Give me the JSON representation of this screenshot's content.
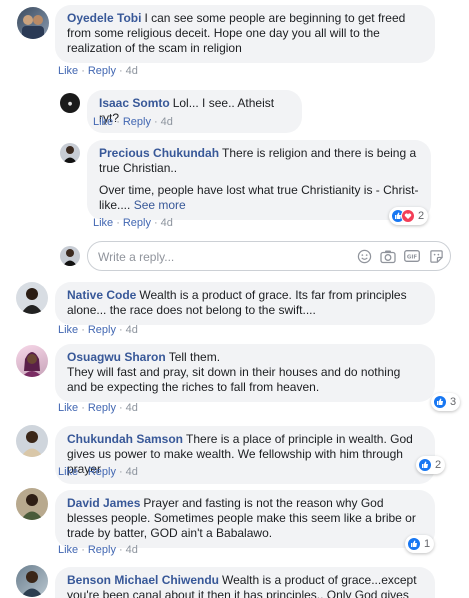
{
  "comments": [
    {
      "author": "Oyedele Tobi",
      "text": "I can see some people are beginning to get freed from some religious deceit. Hope one day you all will to the realization of the scam in religion",
      "like": "Like",
      "reply": "Reply",
      "time": "4d"
    },
    {
      "author": "Native Code",
      "text": "Wealth is a product of grace. Its far from principles alone... the race does not belong to the swift....",
      "like": "Like",
      "reply": "Reply",
      "time": "4d"
    },
    {
      "author": "Osuagwu Sharon",
      "text": "Tell them.",
      "text2": "They will fast and pray, sit down in their houses and do nothing and be expecting the riches to fall from heaven.",
      "like": "Like",
      "reply": "Reply",
      "time": "4d",
      "reactions": "3"
    },
    {
      "author": "Chukundah Samson",
      "text": "There is a place of principle in wealth. God gives us power to make wealth. We fellowship with him through prayer",
      "like": "Like",
      "reply": "Reply",
      "time": "4d",
      "reactions": "2"
    },
    {
      "author": "David James",
      "text": "Prayer and fasting is not the reason why God blesses people. Sometimes people make this seem like a bribe or trade by batter, GOD ain't a Babalawo.",
      "like": "Like",
      "reply": "Reply",
      "time": "4d",
      "reactions": "1"
    },
    {
      "author": "Benson Michael Chiwendu",
      "text": "Wealth is a product of grace...except you're been canal about it then it has principles.. Only God gives and"
    }
  ],
  "replies": [
    {
      "author": "Isaac Somto",
      "text": "Lol... I see.. Atheist ryt?",
      "like": "Like",
      "reply": "Reply",
      "time": "4d"
    },
    {
      "author": "Precious Chukundah",
      "text": "There is religion and there is being a true Christian..",
      "text2": "Over time, people have lost what true Christianity is - Christ-like.... ",
      "see_more": "See more",
      "like": "Like",
      "reply": "Reply",
      "time": "4d",
      "reactions": "2"
    }
  ],
  "reply_box": {
    "placeholder": "Write a reply..."
  },
  "colors": {
    "link": "#385898",
    "action": "#4267b2",
    "bubble": "#f2f3f5",
    "like": "#1877f2",
    "love": "#f33e58"
  },
  "icons": [
    "emoji-icon",
    "camera-icon",
    "gif-icon",
    "sticker-icon",
    "like-reaction-icon",
    "love-reaction-icon"
  ]
}
